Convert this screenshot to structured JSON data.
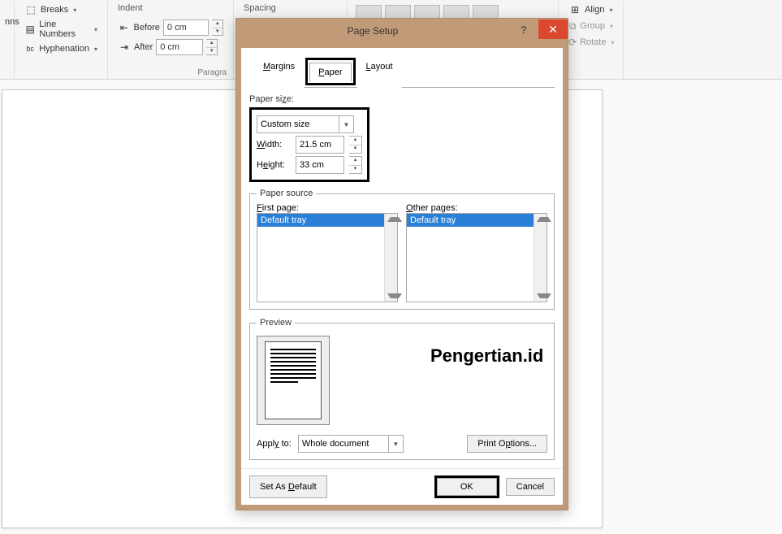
{
  "ribbon": {
    "columns_partial": "nns",
    "breaks": "Breaks",
    "line_numbers": "Line Numbers",
    "hyphenation": "Hyphenation",
    "indent_header": "Indent",
    "spacing_header": "Spacing",
    "before": "Before",
    "after": "After",
    "before_value": "0 cm",
    "after_value": "0 cm",
    "paragraph_label": "Paragra",
    "align": "Align",
    "group": "Group",
    "rotate": "Rotate"
  },
  "dialog": {
    "title": "Page Setup",
    "tabs": {
      "margins": "Margins",
      "paper": "Paper",
      "layout": "Layout"
    },
    "paper_size_label": "Paper size:",
    "paper_size_value": "Custom size",
    "width_label": "Width:",
    "width_value": "21.5 cm",
    "height_label": "Height:",
    "height_value": "33 cm",
    "paper_source_label": "Paper source",
    "first_page_label": "First page:",
    "other_pages_label": "Other pages:",
    "default_tray": "Default tray",
    "preview_label": "Preview",
    "apply_to_label": "Apply to:",
    "apply_to_value": "Whole document",
    "print_options": "Print Options...",
    "set_default": "Set As Default",
    "ok": "OK",
    "cancel": "Cancel"
  },
  "watermark": "Pengertian.id"
}
